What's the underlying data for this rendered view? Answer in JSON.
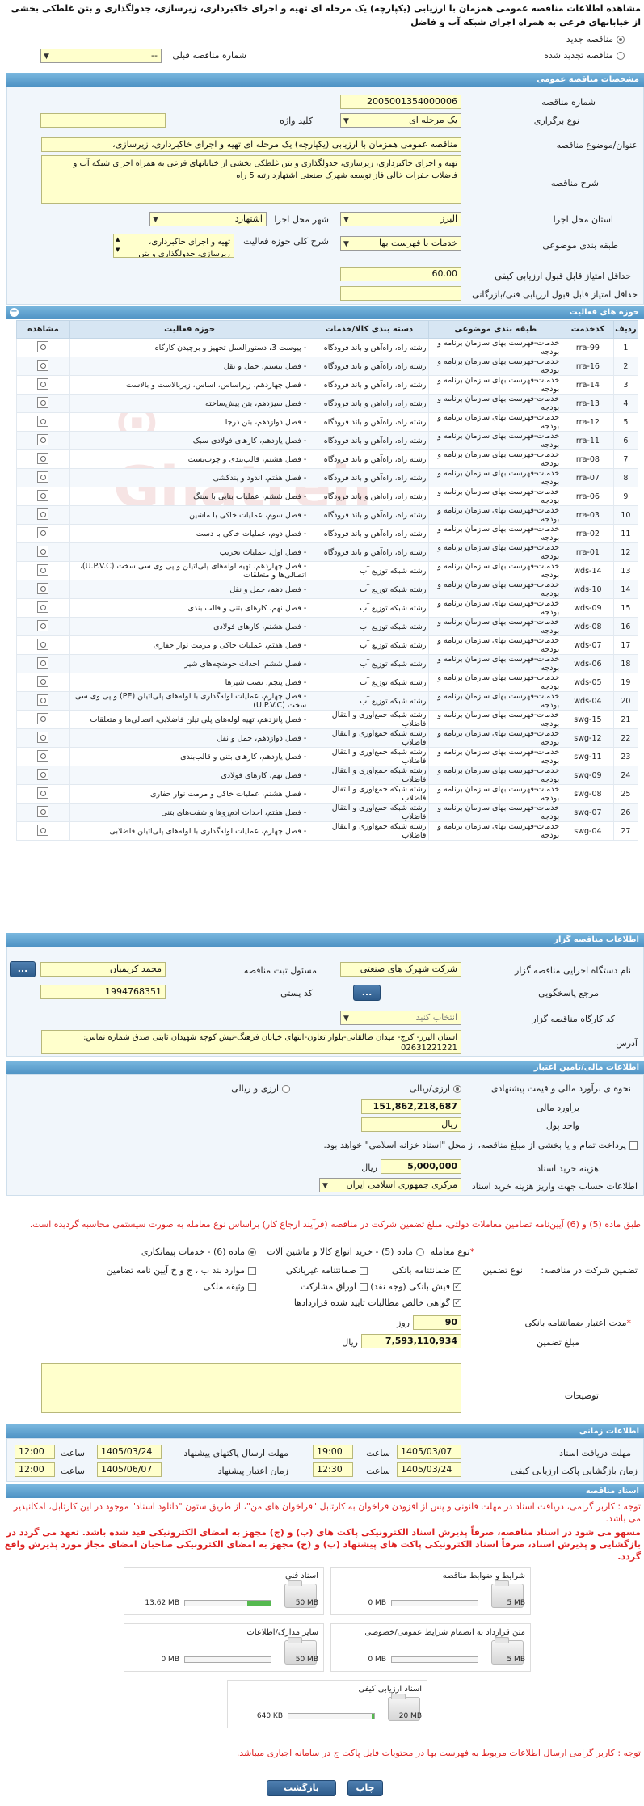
{
  "title": "مشاهده اطلاعات مناقصه عمومی همزمان با ارزیابی (یکپارچه) یک مرحله ای تهیه و اجرای خاکبرداری، زیرسازی، جدولگذاری و بتن غلطکی بخشی از خیابانهای فرعی به همراه اجرای شبکه آب و فاضل",
  "top": {
    "new_tender": "مناقصه جدید",
    "renewed_tender": "مناقصه تجدید شده",
    "prev_number_label": "شماره مناقصه قبلی",
    "prev_number_value": "--"
  },
  "general": {
    "header": "مشخصات مناقصه عمومی",
    "number_label": "شماره مناقصه",
    "number_value": "2005001354000006",
    "type_label": "نوع برگزاری",
    "type_value": "یک مرحله ای",
    "keyword_label": "کلید واژه",
    "keyword_value": "",
    "subject_label": "عنوان/موضوع مناقصه",
    "subject_value": "مناقصه عمومی همزمان با ارزیابی (یکپارچه) یک مرحله ای تهیه و اجرای خاکبرداری، زیرسازی،",
    "desc_label": "شرح مناقصه",
    "desc_value": "تهیه و اجرای خاکبرداری، زیرسازی، جدولگذاری و بتن غلطکی بخشی از خیابانهای فرعی به همراه اجرای شبکه آب و فاضلاب حفرات خالی فاز توسعه شهرک صنعتی اشتهارد رتبه 5 راه",
    "province_label": "استان محل اجرا",
    "province_value": "البرز",
    "city_label": "شهر محل اجرا",
    "city_value": "اشتهارد",
    "category_label": "طبقه بندی موضوعی",
    "category_value": "خدمات با فهرست بها",
    "activity_label": "شرح کلی حوزه فعالیت",
    "activity_value": "تهیه و اجرای خاکبرداری، زیرسازی، جدولگذاری و بتن",
    "min_quality_label": "حداقل امتیاز قابل قبول ارزیابی کیفی",
    "min_quality_value": "60.00",
    "min_tech_label": "حداقل امتیاز قابل قبول ارزیابی فنی/بازرگانی",
    "min_tech_value": ""
  },
  "activities": {
    "header": "حوزه های فعالیت",
    "columns": [
      "ردیف",
      "کدخدمت",
      "طبقه بندی موضوعی",
      "دسته بندی کالا/خدمات",
      "حوزه فعالیت",
      "مشاهده"
    ],
    "rows": [
      [
        "1",
        "rra-99",
        "خدمات-فهرست بهای سازمان برنامه و بودجه",
        "رشته راه، راه‌آهن و باند فرودگاه",
        "- پیوست 3، دستورالعمل تجهیز و برچیدن کارگاه"
      ],
      [
        "2",
        "rra-16",
        "خدمات-فهرست بهای سازمان برنامه و بودجه",
        "رشته راه، راه‌آهن و باند فرودگاه",
        "- فصل بیستم، حمل و نقل"
      ],
      [
        "3",
        "rra-14",
        "خدمات-فهرست بهای سازمان برنامه و بودجه",
        "رشته راه، راه‌آهن و باند فرودگاه",
        "- فصل چهاردهم، زیراساس، اساس، زیربالاست و بالاست"
      ],
      [
        "4",
        "rra-13",
        "خدمات-فهرست بهای سازمان برنامه و بودجه",
        "رشته راه، راه‌آهن و باند فرودگاه",
        "- فصل سیزدهم، بتن پیش‌ساخته"
      ],
      [
        "5",
        "rra-12",
        "خدمات-فهرست بهای سازمان برنامه و بودجه",
        "رشته راه، راه‌آهن و باند فرودگاه",
        "- فصل دوازدهم، بتن درجا"
      ],
      [
        "6",
        "rra-11",
        "خدمات-فهرست بهای سازمان برنامه و بودجه",
        "رشته راه، راه‌آهن و باند فرودگاه",
        "- فصل یازدهم، کارهای فولادی سبک"
      ],
      [
        "7",
        "rra-08",
        "خدمات-فهرست بهای سازمان برنامه و بودجه",
        "رشته راه، راه‌آهن و باند فرودگاه",
        "- فصل هشتم، قالب‌بندی و چوب‌بست"
      ],
      [
        "8",
        "rra-07",
        "خدمات-فهرست بهای سازمان برنامه و بودجه",
        "رشته راه، راه‌آهن و باند فرودگاه",
        "- فصل هفتم، اندود و بندکشی"
      ],
      [
        "9",
        "rra-06",
        "خدمات-فهرست بهای سازمان برنامه و بودجه",
        "رشته راه، راه‌آهن و باند فرودگاه",
        "- فصل ششم، عملیات بنایی با سنگ"
      ],
      [
        "10",
        "rra-03",
        "خدمات-فهرست بهای سازمان برنامه و بودجه",
        "رشته راه، راه‌آهن و باند فرودگاه",
        "- فصل سوم، عملیات خاکی با ماشین"
      ],
      [
        "11",
        "rra-02",
        "خدمات-فهرست بهای سازمان برنامه و بودجه",
        "رشته راه، راه‌آهن و باند فرودگاه",
        "- فصل دوم، عملیات خاکی با دست"
      ],
      [
        "12",
        "rra-01",
        "خدمات-فهرست بهای سازمان برنامه و بودجه",
        "رشته راه، راه‌آهن و باند فرودگاه",
        "- فصل اول، عملیات تخریب"
      ],
      [
        "13",
        "wds-14",
        "خدمات-فهرست بهای سازمان برنامه و بودجه",
        "رشته شبکه توزیع آب",
        "- فصل چهاردهم، تهیه لوله‌های پلی‌اتیلن و پی وی سی سخت (U.P.V.C)، اتصالی‌ها و متعلقات"
      ],
      [
        "14",
        "wds-10",
        "خدمات-فهرست بهای سازمان برنامه و بودجه",
        "رشته شبکه توزیع آب",
        "- فصل دهم، حمل و نقل"
      ],
      [
        "15",
        "wds-09",
        "خدمات-فهرست بهای سازمان برنامه و بودجه",
        "رشته شبکه توزیع آب",
        "- فصل نهم، کارهای بتنی و قالب بندی"
      ],
      [
        "16",
        "wds-08",
        "خدمات-فهرست بهای سازمان برنامه و بودجه",
        "رشته شبکه توزیع آب",
        "- فصل هشتم، کارهای فولادی"
      ],
      [
        "17",
        "wds-07",
        "خدمات-فهرست بهای سازمان برنامه و بودجه",
        "رشته شبکه توزیع آب",
        "- فصل هفتم، عملیات خاکی و مرمت نوار حفاری"
      ],
      [
        "18",
        "wds-06",
        "خدمات-فهرست بهای سازمان برنامه و بودجه",
        "رشته شبکه توزیع آب",
        "- فصل ششم، احداث حوضچه‌های شیر"
      ],
      [
        "19",
        "wds-05",
        "خدمات-فهرست بهای سازمان برنامه و بودجه",
        "رشته شبکه توزیع آب",
        "- فصل پنجم، نصب شیرها"
      ],
      [
        "20",
        "wds-04",
        "خدمات-فهرست بهای سازمان برنامه و بودجه",
        "رشته شبکه توزیع آب",
        "- فصل چهارم، عملیات لوله‌گذاری با لوله‌های پلی‌اتیلن (PE) و پی وی سی سخت (U.P.V.C)"
      ],
      [
        "21",
        "swg-15",
        "خدمات-فهرست بهای سازمان برنامه و بودجه",
        "رشته شبکه جمع‌آوری و انتقال فاضلاب",
        "- فصل پانزدهم، تهیه لوله‌های پلی‌اتیلن فاضلابی، اتصالی‌ها و متعلقات"
      ],
      [
        "22",
        "swg-12",
        "خدمات-فهرست بهای سازمان برنامه و بودجه",
        "رشته شبکه جمع‌آوری و انتقال فاضلاب",
        "- فصل دوازدهم، حمل و نقل"
      ],
      [
        "23",
        "swg-11",
        "خدمات-فهرست بهای سازمان برنامه و بودجه",
        "رشته شبکه جمع‌آوری و انتقال فاضلاب",
        "- فصل یازدهم، کارهای بتنی و قالب‌بندی"
      ],
      [
        "24",
        "swg-09",
        "خدمات-فهرست بهای سازمان برنامه و بودجه",
        "رشته شبکه جمع‌آوری و انتقال فاضلاب",
        "- فصل نهم، کارهای فولادی"
      ],
      [
        "25",
        "swg-08",
        "خدمات-فهرست بهای سازمان برنامه و بودجه",
        "رشته شبکه جمع‌آوری و انتقال فاضلاب",
        "- فصل هشتم، عملیات خاکی و مرمت نوار حفاری"
      ],
      [
        "26",
        "swg-07",
        "خدمات-فهرست بهای سازمان برنامه و بودجه",
        "رشته شبکه جمع‌آوری و انتقال فاضلاب",
        "- فصل هفتم، احداث آدم‌روها و شفت‌های بتنی"
      ],
      [
        "27",
        "swg-04",
        "خدمات-فهرست بهای سازمان برنامه و بودجه",
        "رشته شبکه جمع‌آوری و انتقال فاضلاب",
        "- فصل چهارم، عملیات لوله‌گذاری با لوله‌های پلی‌اتیلن فاضلابی"
      ]
    ]
  },
  "organizer": {
    "header": "اطلاعات مناقصه گزار",
    "org_label": "نام دستگاه اجرایی مناقصه گزار",
    "org_value": "شرکت شهرک های صنعتی",
    "responsible_label": "مسئول ثبت مناقصه",
    "responsible_value": "محمد کریمیان",
    "ref_label": "مرجع پاسخگویی",
    "postal_label": "کد پستی",
    "postal_value": "1994768351",
    "workshop_label": "کد کارگاه مناقصه گزار",
    "workshop_value": "انتخاب کنید",
    "address_label": "آدرس",
    "address_value": "استان البرز- کرج- میدان طالقانی-بلوار تعاون-انتهای خیابان فرهنگ-نبش کوچه شهیدان ثابتی صدق شماره تماس: 02631221221",
    "dots": "..."
  },
  "finance": {
    "header": "اطلاعات مالی/تامین اعتبار",
    "estimate_label": "نحوه ی برآورد مالی و قیمت پیشنهادی",
    "opt_currency": "ارزی/ریالی",
    "opt_rial": "ارزی و ریالی",
    "estimate_amount_label": "برآورد مالی",
    "estimate_amount_value": "151,862,218,687",
    "unit_label": "واحد پول",
    "unit_value": "ریال",
    "treasury_text": "پرداخت تمام و یا بخشی از مبلغ مناقصه، از محل \"اسناد خزانه اسلامی\" خواهد بود.",
    "doc_cost_label": "هزینه خرید اسناد",
    "doc_cost_value": "5,000,000",
    "doc_cost_unit": "ریال",
    "account_label": "اطلاعات حساب جهت واریز هزینه خرید اسناد",
    "account_value": "مرکزی جمهوری اسلامی ایران"
  },
  "guarantee": {
    "notice": "طبق ماده (5) و (6) آیین‌نامه تضامین معاملات دولتی، مبلغ تضمین شرکت در مناقصه (فرآیند ارجاع کار) براساس نوع معامله به صورت سیستمی محاسبه گردیده است.",
    "type_label": "نوع معامله",
    "type_opt1": "ماده (5) - خرید انواع کالا و ماشین آلات",
    "type_opt2": "ماده (6) - خدمات پیمانکاری",
    "guar_label": "تضمین شرکت در مناقصه:",
    "guar_type_label": "نوع تضمین",
    "opt_bank": "ضمانتنامه بانکی",
    "opt_nonbank": "ضمانتنامه غیربانکی",
    "opt_wage": "موارد بند ب ، ج و خ آیین نامه تضامین",
    "opt_check": "فیش بانکی (وجه نقد)",
    "opt_bonds": "اوراق مشارکت",
    "opt_property": "وثیقه ملکی",
    "opt_certificate": "گواهی خالص مطالبات تایید شده قراردادها",
    "validity_label": "مدت اعتبار ضمانتنامه بانکی",
    "validity_value": "90",
    "validity_unit": "روز",
    "amount_label": "مبلغ تضمین",
    "amount_value": "7,593,110,934",
    "amount_unit": "ریال",
    "desc_label": "توضیحات",
    "desc_value": ""
  },
  "time": {
    "header": "اطلاعات زمانی",
    "receive_label": "مهلت دریافت اسناد",
    "receive_date": "1405/03/07",
    "receive_time": "19:00",
    "send_label": "مهلت ارسال پاکتهای پیشنهاد",
    "send_date": "1405/03/24",
    "send_time": "12:00",
    "open_label": "زمان بازگشایی پاکت ارزیابی کیفی",
    "open_date": "1405/03/24",
    "open_time": "12:30",
    "validity_label": "زمان اعتبار پیشنهاد",
    "validity_date": "1405/06/07",
    "validity_time": "12:00",
    "hour_label": "ساعت"
  },
  "docs": {
    "header": "اسناد مناقصه",
    "notice1": "توجه : کاربر گرامی، دریافت اسناد در مهلت قانونی و پس از افزودن فراخوان به کارتابل \"فراخوان های من\"، از طریق ستون \"دانلود اسناد\" موجود در این کارتابل، امکانپذیر می باشد.",
    "notice2": "مسهو می شود در اسناد مناقصه، صرفاً پذیرش اسناد الکترونیکی پاکت های (ب) و (ج) مجهز به امضای الکترونیکی قید شده باشد. تعهد می گردد در بازگشایی و پذیرش اسناد، صرفاً اسناد الکترونیکی پاکت های پیشنهاد (ب) و (ج) مجهز به امضای الکترونیکی صاحبان امضای مجاز مورد پذیرش واقع گردد.",
    "files": [
      {
        "name": "شرایط و ضوابط مناقصه",
        "used": "0 MB",
        "max": "5 MB",
        "fill": 0
      },
      {
        "name": "اسناد فنی",
        "used": "13.62 MB",
        "max": "50 MB",
        "fill": 0.27
      },
      {
        "name": "متن قرارداد به انضمام شرایط عمومی/خصوصی",
        "used": "0 MB",
        "max": "5 MB",
        "fill": 0
      },
      {
        "name": "سایر مدارک/اطلاعات",
        "used": "0 MB",
        "max": "50 MB",
        "fill": 0
      },
      {
        "name": "اسناد ارزیابی کیفی",
        "used": "640 KB",
        "max": "20 MB",
        "fill": 0.03
      }
    ],
    "footer_notice": "توجه : کاربر گرامی ارسال اطلاعات مربوط به فهرست بها در محتویات فایل پاکت ج در سامانه اجباری میباشد."
  },
  "buttons": {
    "back": "بازگشت",
    "print": "چاپ"
  }
}
